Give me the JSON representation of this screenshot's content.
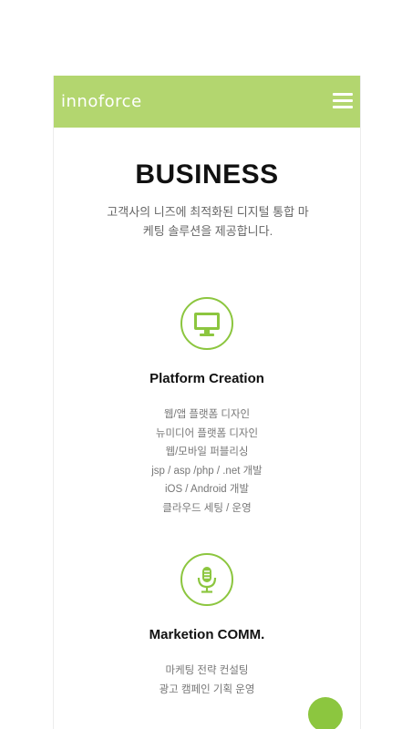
{
  "header": {
    "logo": "innoforce",
    "menu_icon": "hamburger-menu-icon",
    "accent": "#b3d66f"
  },
  "intro": {
    "title": "BUSINESS",
    "subtitle_line1": "고객사의 니즈에 최적화된 디지털 통합 마",
    "subtitle_line2": "케팅 솔루션을 제공합니다."
  },
  "services": [
    {
      "icon": "monitor-icon",
      "title": "Platform Creation",
      "items": [
        "웹/앱 플랫폼 디자인",
        "뉴미디어 플랫폼 디자인",
        "웹/모바일 퍼블리싱",
        "jsp / asp /php / .net 개발",
        "iOS / Android 개발",
        "클라우드 세팅 / 운영"
      ]
    },
    {
      "icon": "microphone-icon",
      "title": "Marketion COMM.",
      "items": [
        "마케팅 전략 컨설팅",
        "광고 캠페인 기획 운영"
      ]
    }
  ],
  "colors": {
    "icon_green": "#8cc63f",
    "title": "#111111",
    "text": "#777777"
  }
}
